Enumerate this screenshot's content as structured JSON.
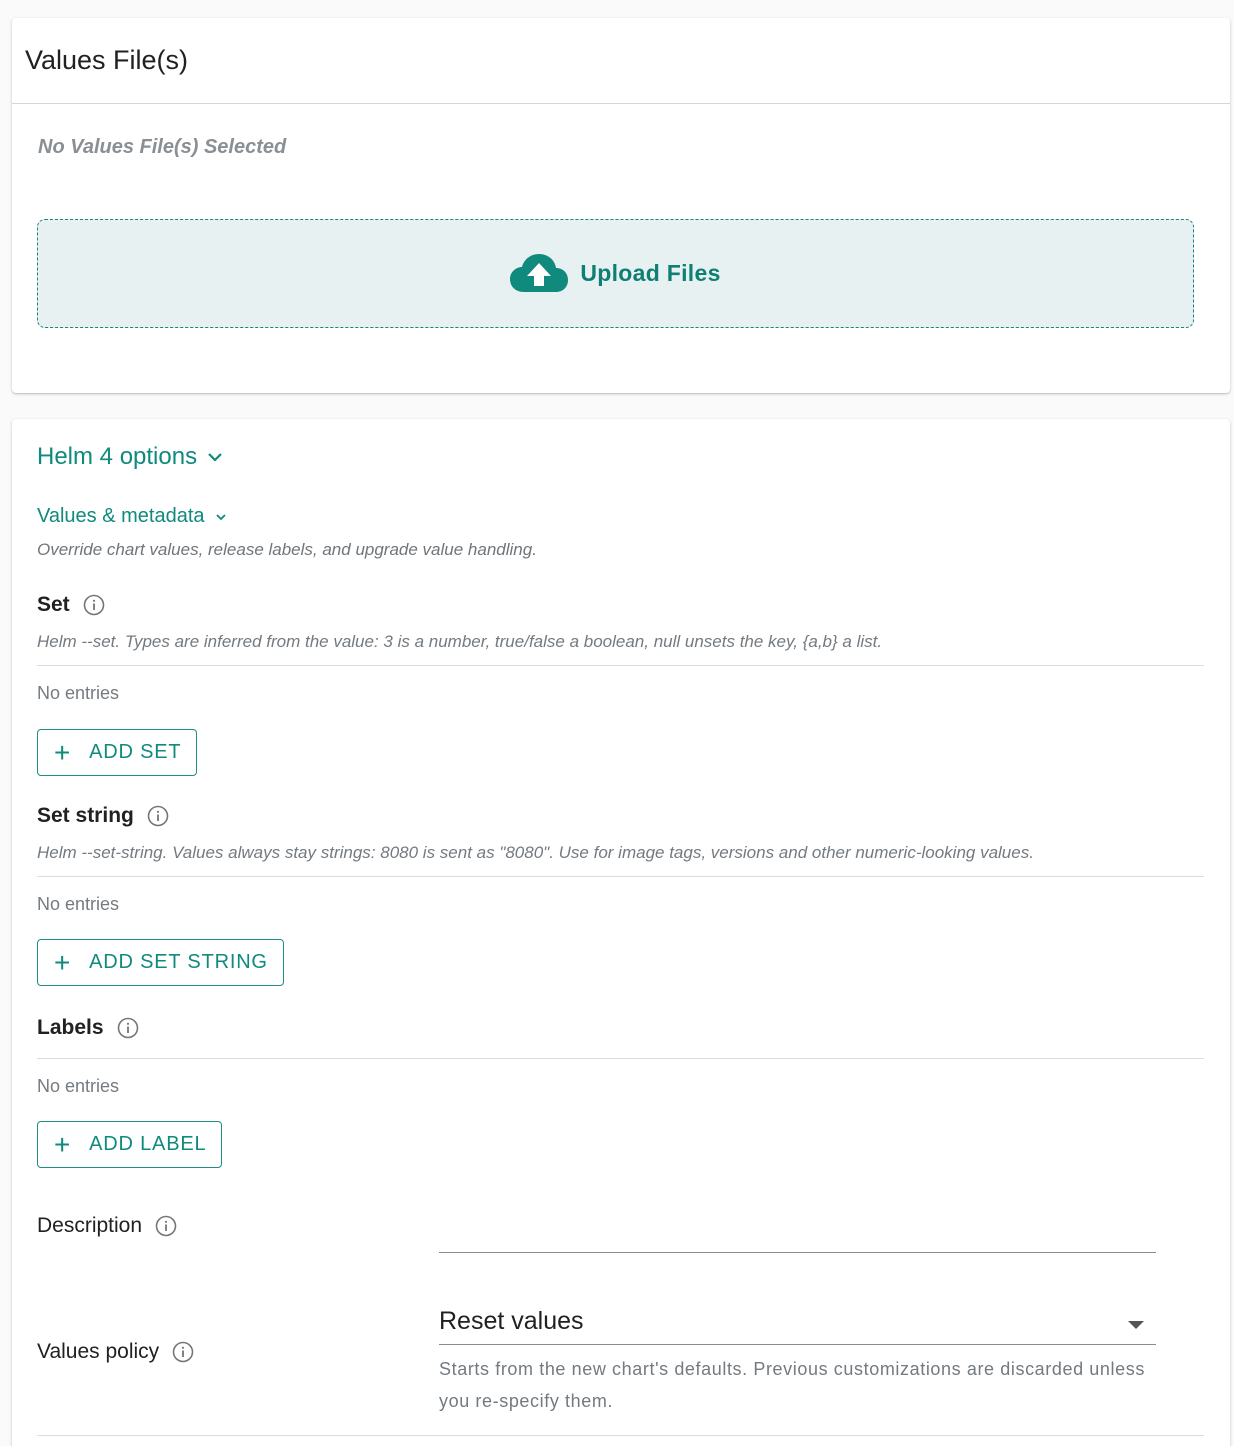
{
  "values_files": {
    "title": "Values File(s)",
    "empty_text": "No Values File(s) Selected",
    "upload_label": "Upload Files",
    "upload_icon": "cloud-upload-icon"
  },
  "helm_options": {
    "title": "Helm 4 options",
    "section": {
      "title": "Values & metadata",
      "description": "Override chart values, release labels, and upgrade value handling."
    },
    "set": {
      "label": "Set",
      "hint": "Helm --set. Types are inferred from the value: 3 is a number, true/false a boolean, null unsets the key, {a,b} a list.",
      "empty": "No entries",
      "button": "ADD SET"
    },
    "set_string": {
      "label": "Set string",
      "hint": "Helm --set-string. Values always stay strings: 8080 is sent as \"8080\". Use for image tags, versions and other numeric-looking values.",
      "empty": "No entries",
      "button": "ADD SET STRING"
    },
    "labels": {
      "label": "Labels",
      "empty": "No entries",
      "button": "ADD LABEL"
    },
    "description": {
      "label": "Description",
      "value": ""
    },
    "values_policy": {
      "label": "Values policy",
      "selected": "Reset values",
      "help": "Starts from the new chart's defaults. Previous customizations are discarded unless you re-specify them."
    }
  },
  "colors": {
    "accent": "#0f8a7c",
    "dropzone_bg": "#e8f1f1",
    "muted_text": "#737a80"
  },
  "icons": {
    "info": "info-icon",
    "chevron": "chevron-down-icon",
    "plus": "plus-icon"
  }
}
